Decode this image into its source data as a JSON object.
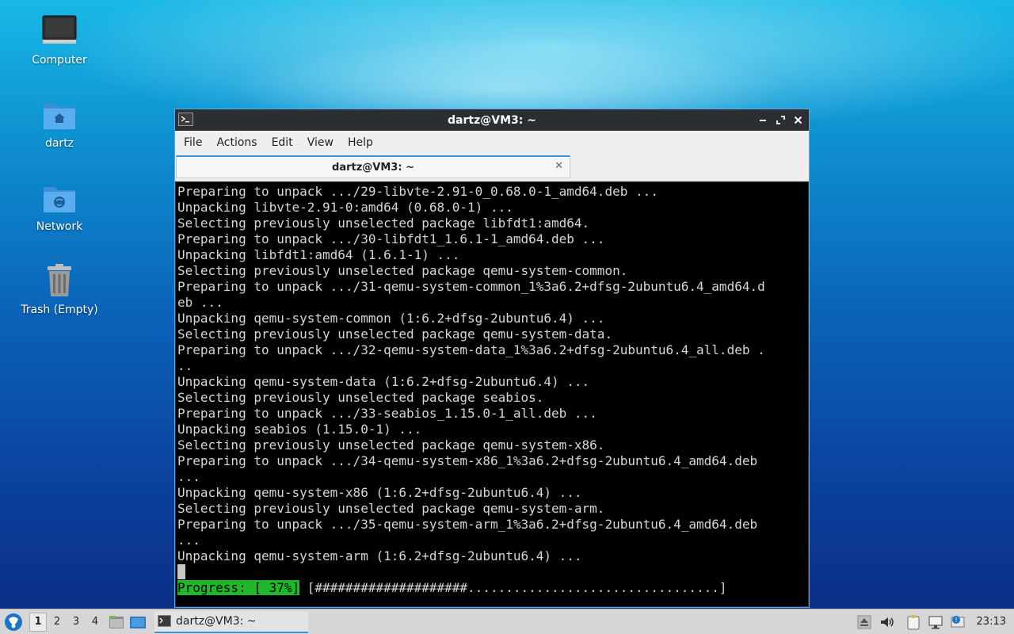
{
  "desktop": {
    "icons": [
      {
        "label": "Computer",
        "icon": "computer-icon"
      },
      {
        "label": "dartz",
        "icon": "home-folder-icon"
      },
      {
        "label": "Network",
        "icon": "network-folder-icon"
      },
      {
        "label": "Trash (Empty)",
        "icon": "trash-icon"
      }
    ]
  },
  "window": {
    "title": "dartz@VM3: ~",
    "menu": [
      "File",
      "Actions",
      "Edit",
      "View",
      "Help"
    ],
    "tab": {
      "label": "dartz@VM3: ~"
    },
    "terminal": {
      "lines": [
        "Preparing to unpack .../29-libvte-2.91-0_0.68.0-1_amd64.deb ...",
        "Unpacking libvte-2.91-0:amd64 (0.68.0-1) ...",
        "Selecting previously unselected package libfdt1:amd64.",
        "Preparing to unpack .../30-libfdt1_1.6.1-1_amd64.deb ...",
        "Unpacking libfdt1:amd64 (1.6.1-1) ...",
        "Selecting previously unselected package qemu-system-common.",
        "Preparing to unpack .../31-qemu-system-common_1%3a6.2+dfsg-2ubuntu6.4_amd64.d",
        "eb ...",
        "Unpacking qemu-system-common (1:6.2+dfsg-2ubuntu6.4) ...",
        "Selecting previously unselected package qemu-system-data.",
        "Preparing to unpack .../32-qemu-system-data_1%3a6.2+dfsg-2ubuntu6.4_all.deb .",
        "..",
        "Unpacking qemu-system-data (1:6.2+dfsg-2ubuntu6.4) ...",
        "Selecting previously unselected package seabios.",
        "Preparing to unpack .../33-seabios_1.15.0-1_all.deb ...",
        "Unpacking seabios (1.15.0-1) ...",
        "Selecting previously unselected package qemu-system-x86.",
        "Preparing to unpack .../34-qemu-system-x86_1%3a6.2+dfsg-2ubuntu6.4_amd64.deb",
        "...",
        "Unpacking qemu-system-x86 (1:6.2+dfsg-2ubuntu6.4) ...",
        "Selecting previously unselected package qemu-system-arm.",
        "Preparing to unpack .../35-qemu-system-arm_1%3a6.2+dfsg-2ubuntu6.4_amd64.deb",
        "...",
        "Unpacking qemu-system-arm (1:6.2+dfsg-2ubuntu6.4) ..."
      ],
      "progress_label": "Progress: [ 37%]",
      "progress_bar": " [####################.................................]",
      "progress_percent": 37
    }
  },
  "taskbar": {
    "workspaces": [
      "1",
      "2",
      "3",
      "4"
    ],
    "active_workspace": "1",
    "task_label": "dartz@VM3: ~",
    "clock": "23:13"
  },
  "colors": {
    "progress_green": "#1fb82b",
    "accent_blue": "#3d95d8"
  }
}
